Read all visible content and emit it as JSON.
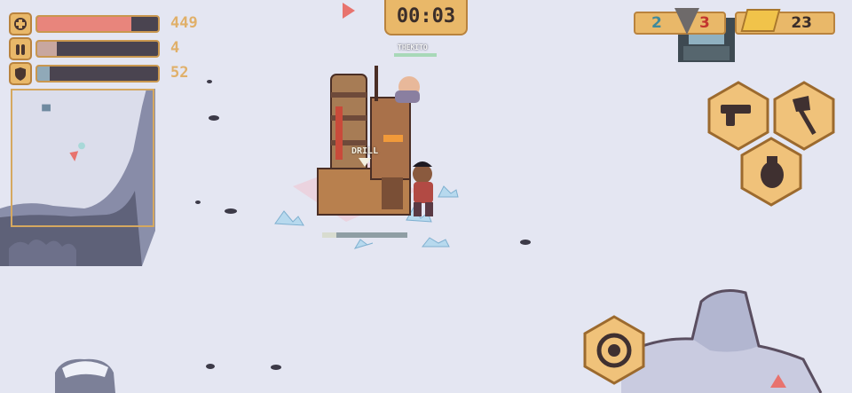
{
  "hud": {
    "health": {
      "value": "449",
      "fraction": 0.78,
      "color": "#e8857c"
    },
    "ammo": {
      "value": "4",
      "fraction": 0.16,
      "color": "#c8a79f"
    },
    "shield": {
      "value": "52",
      "fraction": 0.1,
      "color": "#90a9b8"
    },
    "timer": "00:03"
  },
  "resources": {
    "team_blue": "2",
    "team_red": "3",
    "gold": "23"
  },
  "world": {
    "drill_label": "DRILL",
    "ally_name": "THEKITO"
  },
  "actions": {
    "weapon_pistol": "pistol-icon",
    "weapon_axe": "axe-icon",
    "weapon_grenade": "grenade-icon",
    "swap": "swap-icon"
  }
}
